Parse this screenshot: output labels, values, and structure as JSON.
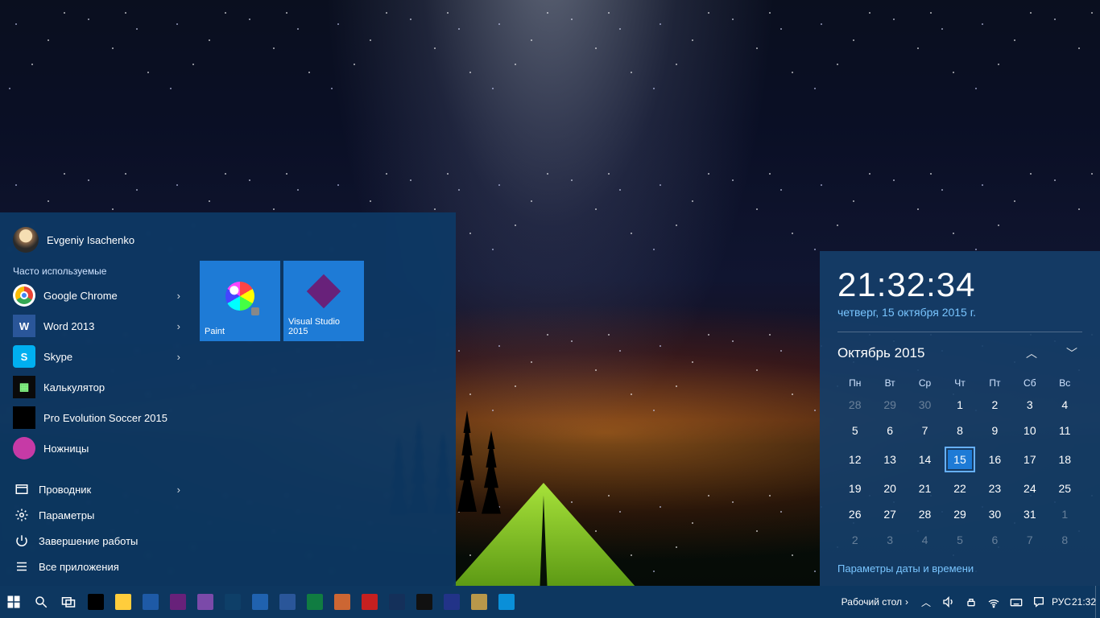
{
  "start": {
    "user_name": "Evgeniy Isachenko",
    "frequent_title": "Часто используемые",
    "frequent": [
      {
        "label": "Google Chrome",
        "has_submenu": true
      },
      {
        "label": "Word 2013",
        "has_submenu": true
      },
      {
        "label": "Skype",
        "has_submenu": true
      },
      {
        "label": "Калькулятор",
        "has_submenu": false
      },
      {
        "label": "Pro Evolution Soccer 2015",
        "has_submenu": false
      },
      {
        "label": "Ножницы",
        "has_submenu": false
      }
    ],
    "system": [
      {
        "label": "Проводник",
        "icon": "explorer",
        "has_submenu": true
      },
      {
        "label": "Параметры",
        "icon": "settings",
        "has_submenu": false
      },
      {
        "label": "Завершение работы",
        "icon": "power",
        "has_submenu": false
      },
      {
        "label": "Все приложения",
        "icon": "all-apps",
        "has_submenu": false
      }
    ],
    "tiles": [
      {
        "label": "Paint",
        "icon": "paint"
      },
      {
        "label": "Visual Studio 2015",
        "icon": "visual-studio"
      }
    ]
  },
  "clock_flyout": {
    "time": "21:32:34",
    "date_long": "четверг, 15 октября 2015 г.",
    "month_title": "Октябрь 2015",
    "dow": [
      "Пн",
      "Вт",
      "Ср",
      "Чт",
      "Пт",
      "Сб",
      "Вс"
    ],
    "weeks": [
      [
        {
          "d": 28,
          "m": true
        },
        {
          "d": 29,
          "m": true
        },
        {
          "d": 30,
          "m": true
        },
        {
          "d": 1
        },
        {
          "d": 2
        },
        {
          "d": 3
        },
        {
          "d": 4
        }
      ],
      [
        {
          "d": 5
        },
        {
          "d": 6
        },
        {
          "d": 7
        },
        {
          "d": 8
        },
        {
          "d": 9
        },
        {
          "d": 10
        },
        {
          "d": 11
        }
      ],
      [
        {
          "d": 12
        },
        {
          "d": 13
        },
        {
          "d": 14
        },
        {
          "d": 15,
          "t": true
        },
        {
          "d": 16
        },
        {
          "d": 17
        },
        {
          "d": 18
        }
      ],
      [
        {
          "d": 19
        },
        {
          "d": 20
        },
        {
          "d": 21
        },
        {
          "d": 22
        },
        {
          "d": 23
        },
        {
          "d": 24
        },
        {
          "d": 25
        }
      ],
      [
        {
          "d": 26
        },
        {
          "d": 27
        },
        {
          "d": 28
        },
        {
          "d": 29
        },
        {
          "d": 30
        },
        {
          "d": 31
        },
        {
          "d": 1,
          "m": true
        }
      ],
      [
        {
          "d": 2,
          "m": true
        },
        {
          "d": 3,
          "m": true
        },
        {
          "d": 4,
          "m": true
        },
        {
          "d": 5,
          "m": true
        },
        {
          "d": 6,
          "m": true
        },
        {
          "d": 7,
          "m": true
        },
        {
          "d": 8,
          "m": true
        }
      ]
    ],
    "settings_link": "Параметры даты и времени"
  },
  "taskbar": {
    "pinned": [
      "chrome",
      "file-explorer",
      "floppy",
      "visual-studio",
      "visual-studio-alt",
      "onenote",
      "calculator",
      "word",
      "excel",
      "uninstaller",
      "aida64",
      "command-prompt",
      "steam",
      "utility",
      "paint",
      "teamviewer"
    ],
    "show_desktop_label": "Рабочий стол",
    "language": "РУС",
    "clock": "21:32"
  }
}
